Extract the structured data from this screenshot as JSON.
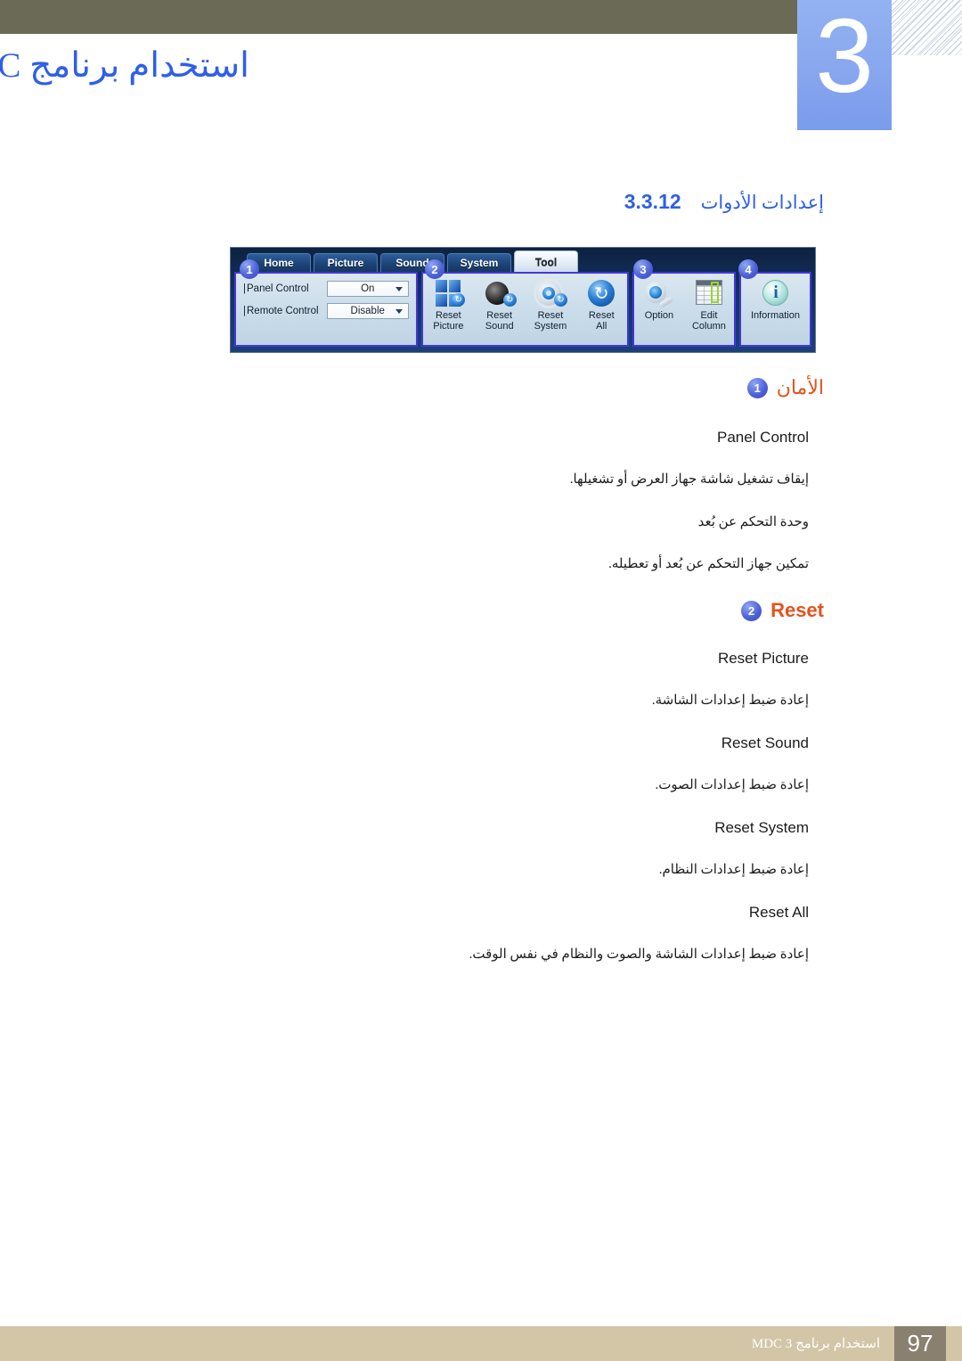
{
  "header": {
    "chapter_number": "3",
    "title": "استخدام برنامج MDC"
  },
  "section": {
    "number": "3.3.12",
    "label": "إعدادات الأدوات"
  },
  "toolbar_screenshot": {
    "tabs": [
      {
        "label": "Home",
        "active": false
      },
      {
        "label": "Picture",
        "active": false
      },
      {
        "label": "Sound",
        "active": false
      },
      {
        "label": "System",
        "active": false
      },
      {
        "label": "Tool",
        "active": true
      }
    ],
    "callouts": [
      "1",
      "2",
      "3",
      "4"
    ],
    "panel_1": {
      "rows": [
        {
          "label": "Panel Control",
          "value": "On"
        },
        {
          "label": "Remote Control",
          "value": "Disable"
        }
      ]
    },
    "panel_2": {
      "buttons": [
        {
          "line1": "Reset",
          "line2": "Picture",
          "icon": "reset-picture-icon"
        },
        {
          "line1": "Reset",
          "line2": "Sound",
          "icon": "reset-sound-icon"
        },
        {
          "line1": "Reset",
          "line2": "System",
          "icon": "reset-system-icon"
        },
        {
          "line1": "Reset",
          "line2": "All",
          "icon": "reset-all-icon"
        }
      ]
    },
    "panel_3": {
      "buttons": [
        {
          "line1": "Option",
          "line2": "",
          "icon": "option-gear-wrench-icon"
        },
        {
          "line1": "Edit",
          "line2": "Column",
          "icon": "edit-column-icon"
        }
      ]
    },
    "panel_4": {
      "buttons": [
        {
          "line1": "Information",
          "line2": "",
          "icon": "information-icon"
        }
      ]
    }
  },
  "sections": [
    {
      "bullet": "1",
      "heading": "الأمان",
      "heading_is_arabic": true,
      "items": [
        {
          "title": "Panel Control",
          "desc": "إيقاف تشغيل شاشة جهاز العرض أو تشغيلها."
        },
        {
          "title": "",
          "desc": "وحدة التحكم عن بُعد"
        },
        {
          "title": "",
          "desc": "تمكين جهاز التحكم عن بُعد أو تعطيله."
        }
      ]
    },
    {
      "bullet": "2",
      "heading": "Reset",
      "heading_is_arabic": false,
      "items": [
        {
          "title": "Reset Picture",
          "desc": "إعادة ضبط إعدادات الشاشة."
        },
        {
          "title": "Reset Sound",
          "desc": "إعادة ضبط إعدادات الصوت."
        },
        {
          "title": "Reset System",
          "desc": "إعادة ضبط إعدادات النظام."
        },
        {
          "title": "Reset All",
          "desc": "إعادة ضبط إعدادات الشاشة والصوت والنظام في نفس الوقت."
        }
      ]
    }
  ],
  "footer": {
    "text": "استخدام برنامج MDC 3",
    "page": "97"
  },
  "colors": {
    "header_bar": "#6b6a57",
    "chapter_blue": "#8aa9ef",
    "title_blue": "#2e5fe8",
    "heading_orange": "#e2531f",
    "bullet_blue": "#4f63d8",
    "footer_bar": "#d2c6a7",
    "footer_page_box": "#8a8070"
  }
}
